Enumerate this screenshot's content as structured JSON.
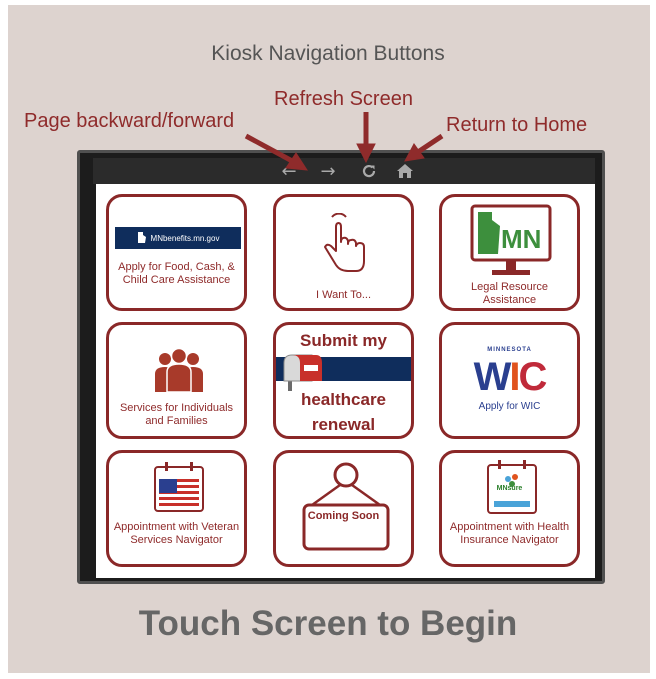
{
  "heading": "Kiosk Navigation Buttons",
  "annotations": {
    "page_back_forward": "Page backward/forward",
    "refresh": "Refresh Screen",
    "return_home": "Return to Home"
  },
  "nav_icons": [
    "arrow-left-icon",
    "arrow-right-icon",
    "refresh-icon",
    "home-icon"
  ],
  "tiles": {
    "food_cash": {
      "logo_text": "MNbenefits.mn.gov",
      "label": "Apply for Food, Cash, & Child Care Assistance"
    },
    "i_want_to": {
      "label": "I Want To..."
    },
    "legal": {
      "logo_text": "MN",
      "label": "Legal Resource Assistance"
    },
    "services": {
      "label": "Services for Individuals and Families"
    },
    "healthcare": {
      "line1": "Submit my",
      "line2": "healthcare",
      "line3": "renewal"
    },
    "wic": {
      "sub": "MINNESOTA",
      "logo_text": "WIC",
      "label": "Apply for WIC"
    },
    "veteran": {
      "label": "Appointment with Veteran Services Navigator"
    },
    "coming_soon": {
      "sign": "Coming Soon"
    },
    "health_insurance": {
      "logo_text": "MNsure",
      "label": "Appointment with Health Insurance Navigator"
    }
  },
  "footer": "Touch Screen to Begin",
  "colors": {
    "accent": "#8a2828",
    "background": "#ddd3cf",
    "text_gray": "#666666"
  }
}
